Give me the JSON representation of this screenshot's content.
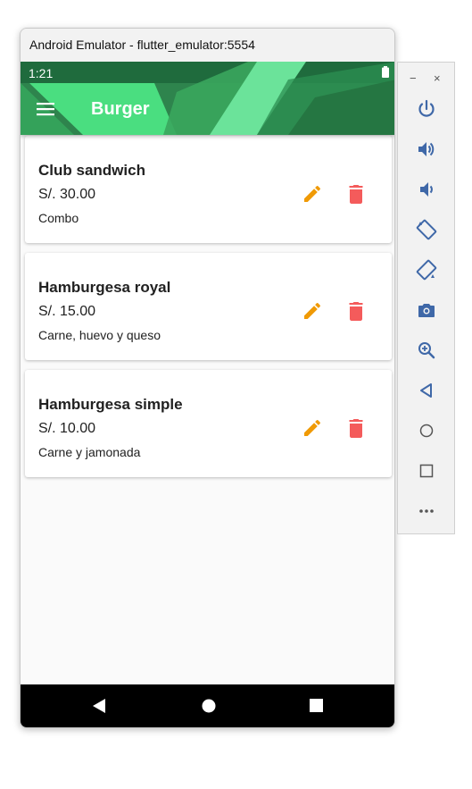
{
  "window": {
    "title": "Android Emulator - flutter_emulator:5554"
  },
  "statusbar": {
    "time": "1:21",
    "battery_icon": "battery-full-icon"
  },
  "appbar": {
    "title": "Burger",
    "menu_icon": "menu-icon"
  },
  "items": [
    {
      "name": "Club sandwich",
      "price": "S/. 30.00",
      "description": "Combo"
    },
    {
      "name": "Hamburgesa royal",
      "price": "S/. 15.00",
      "description": "Carne, huevo y queso"
    },
    {
      "name": "Hamburgesa simple",
      "price": "S/. 10.00",
      "description": "Carne y jamonada"
    }
  ],
  "colors": {
    "edit": "#F09A05",
    "delete": "#F45B5B",
    "appbar_dark": "#2E7D4B",
    "appbar_light": "#4ADE80"
  },
  "navbar": [
    "back-icon",
    "home-icon",
    "recents-icon"
  ],
  "sidepanel": {
    "minimize": "−",
    "close": "×",
    "buttons": [
      "power-icon",
      "volume-up-icon",
      "volume-down-icon",
      "rotate-left-icon",
      "rotate-right-icon",
      "camera-icon",
      "zoom-icon",
      "back-icon",
      "home-icon",
      "overview-icon",
      "more-icon"
    ]
  }
}
